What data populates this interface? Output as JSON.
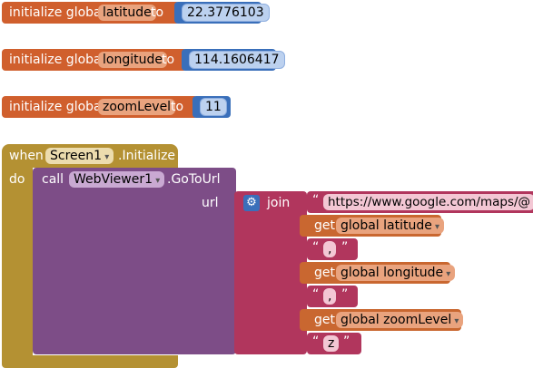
{
  "globals": [
    {
      "prefix": "initialize global",
      "name": "latitude",
      "to": "to",
      "value": "22.3776103"
    },
    {
      "prefix": "initialize global",
      "name": "longitude",
      "to": "to",
      "value": "114.1606417"
    },
    {
      "prefix": "initialize global",
      "name": "zoomLevel",
      "to": "to",
      "value": "11"
    }
  ],
  "event": {
    "when": "when",
    "component": "Screen1",
    "event_name": ".Initialize",
    "do": "do"
  },
  "call": {
    "call": "call",
    "component": "WebViewer1",
    "method": ".GoToUrl",
    "param": "url"
  },
  "join": {
    "label": "join",
    "open_quote": "“",
    "close_quote": "”",
    "url_text": "https://www.google.com/maps/@",
    "get_label": "get",
    "get_latitude": "global latitude",
    "comma1": ",",
    "get_longitude": "global longitude",
    "comma2": ",",
    "get_zoom": "global zoomLevel",
    "z_text": "z"
  },
  "colors": {
    "variable": "#d05f2d",
    "math": "#3a6fba",
    "event": "#b49133",
    "component": "#7d4d87",
    "text": "#b1365d"
  }
}
